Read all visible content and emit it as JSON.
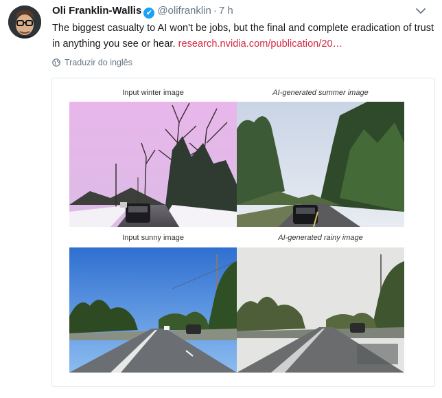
{
  "tweet": {
    "author_name": "Oli Franklin-Wallis",
    "verified_badge": "✔",
    "handle": "@olifranklin",
    "separator": "·",
    "time": "7 h",
    "text": "The biggest casualty to AI won't be jobs, but the final and complete eradication of trust in anything you see or hear. ",
    "link": "research.nvidia.com/publication/20…",
    "translate_label": "Traduzir do inglês"
  },
  "figure": {
    "captions": {
      "top_left": "Input winter image",
      "top_right": "AI-generated  summer image",
      "bottom_left": "Input sunny image",
      "bottom_right": "AI-generated  rainy image"
    }
  },
  "colors": {
    "link": "#d6263f",
    "verified": "#1da1f2",
    "muted": "#657786"
  },
  "icons": [
    "avatar",
    "verified-icon",
    "chevron-down-icon",
    "globe-icon"
  ]
}
